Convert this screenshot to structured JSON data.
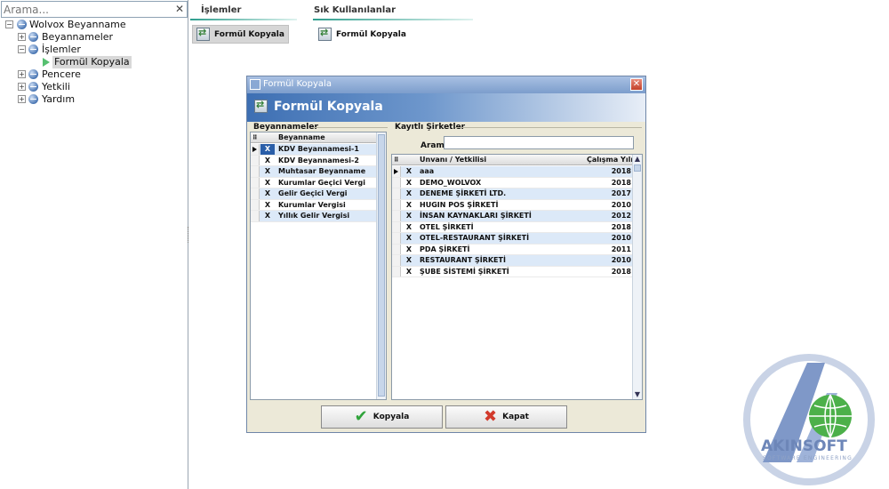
{
  "search": {
    "placeholder": "Arama..."
  },
  "tree": {
    "root": "Wolvox Beyanname",
    "items": [
      {
        "label": "Beyannameler"
      },
      {
        "label": "İşlemler"
      },
      {
        "label": "Formül Kopyala"
      },
      {
        "label": "Pencere"
      },
      {
        "label": "Yetkili"
      },
      {
        "label": "Yardım"
      }
    ]
  },
  "tabs": [
    {
      "label": "İşlemler",
      "button": "Formül Kopyala"
    },
    {
      "label": "Sık Kullanılanlar",
      "button": "Formül Kopyala"
    }
  ],
  "dialog": {
    "title": "Formül Kopyala",
    "header": "Formül Kopyala",
    "left_group": "Beyannameler",
    "left_column": "Beyanname",
    "beyannameler": [
      {
        "check": "X",
        "name": "KDV Beyannamesi-1"
      },
      {
        "check": "X",
        "name": "KDV Beyannamesi-2"
      },
      {
        "check": "X",
        "name": "Muhtasar Beyanname"
      },
      {
        "check": "X",
        "name": "Kurumlar Geçici Vergi"
      },
      {
        "check": "X",
        "name": "Gelir Geçici Vergi"
      },
      {
        "check": "X",
        "name": "Kurumlar Vergisi"
      },
      {
        "check": "X",
        "name": "Yıllık Gelir Vergisi"
      }
    ],
    "right_group": "Kayıtlı Şirketler",
    "arama_label": "Arama",
    "arama_value": "",
    "right_columns": {
      "name": "Unvanı / Yetkilisi",
      "year": "Çalışma Yılı"
    },
    "sirketler": [
      {
        "check": "X",
        "name": "aaa",
        "year": "2018"
      },
      {
        "check": "X",
        "name": "DEMO_WOLVOX",
        "year": "2018"
      },
      {
        "check": "X",
        "name": "DENEME ŞİRKETİ LTD.",
        "year": "2017"
      },
      {
        "check": "X",
        "name": "HUGIN POS ŞİRKETİ",
        "year": "2010"
      },
      {
        "check": "X",
        "name": "İNSAN KAYNAKLARI ŞİRKETİ",
        "year": "2012"
      },
      {
        "check": "X",
        "name": "OTEL ŞİRKETİ",
        "year": "2018"
      },
      {
        "check": "X",
        "name": "OTEL-RESTAURANT ŞİRKETİ",
        "year": "2010"
      },
      {
        "check": "X",
        "name": "PDA ŞİRKETİ",
        "year": "2011"
      },
      {
        "check": "X",
        "name": "RESTAURANT ŞİRKETİ",
        "year": "2010"
      },
      {
        "check": "X",
        "name": "ŞUBE SİSTEMİ ŞİRKETİ",
        "year": "2018"
      }
    ],
    "ok_label": "Kopyala",
    "cancel_label": "Kapat"
  },
  "logo": {
    "name": "AKINSOFT",
    "tagline": "SOFTWARE ENGINEERING"
  },
  "colors": {
    "accent": "#3d6fb3",
    "row_alt": "#dce9f8",
    "ok": "#2fa33a",
    "cancel": "#d23a2c"
  }
}
